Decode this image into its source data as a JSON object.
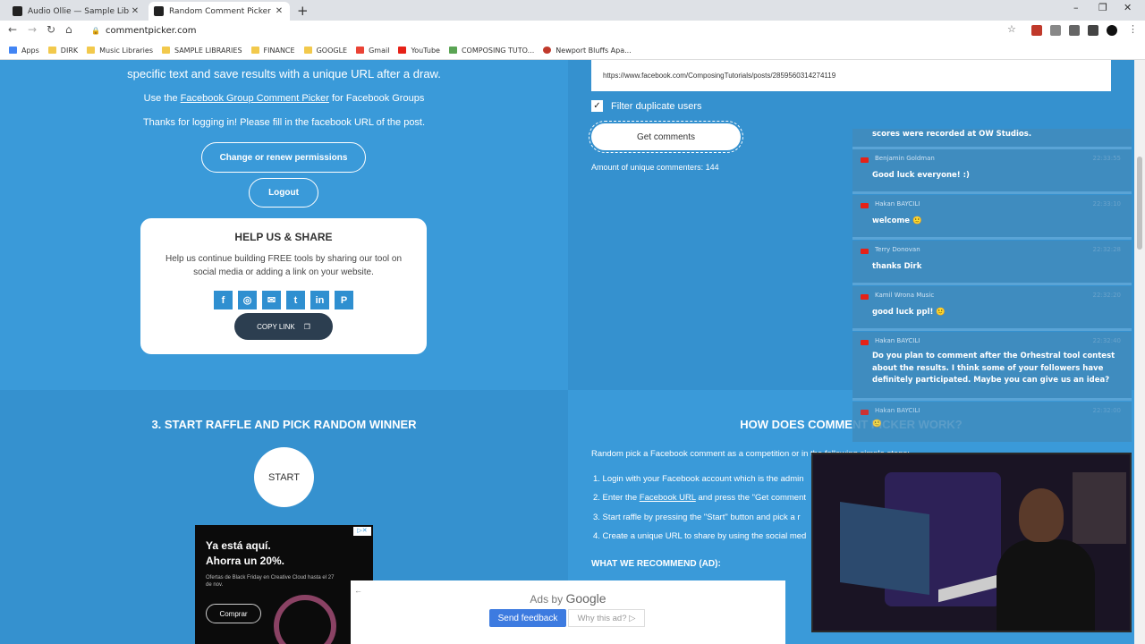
{
  "browser": {
    "tabs": [
      {
        "title": "Audio Ollie — Sample Libraries a"
      },
      {
        "title": "Random Comment Picker for Fac"
      }
    ],
    "url": "commentpicker.com",
    "bookmarks": [
      "Apps",
      "DIRK",
      "Music Libraries",
      "SAMPLE LIBRARIES",
      "FINANCE",
      "GOOGLE",
      "Gmail",
      "YouTube",
      "COMPOSING TUTO...",
      "Newport Bluffs Apa..."
    ]
  },
  "left": {
    "intro": "specific text and save results with a unique URL after a draw.",
    "group_prefix": "Use the ",
    "group_link": "Facebook Group Comment Picker",
    "group_suffix": " for Facebook Groups",
    "logged_in": "Thanks for logging in! Please fill in the facebook URL of the post.",
    "renew_button": "Change or renew permissions",
    "logout_button": "Logout",
    "share_title": "HELP US & SHARE",
    "share_text": "Help us continue building FREE tools by sharing our tool on social media or adding a link on your website.",
    "copy_link": "COPY LINK",
    "raffle_title": "3. START RAFFLE AND PICK RANDOM WINNER",
    "start_button": "START"
  },
  "right": {
    "post_url": "https://www.facebook.com/ComposingTutorials/posts/2859560314274119",
    "filter_label": "Filter duplicate users",
    "get_comments": "Get comments",
    "amount": "Amount of unique commenters: 144",
    "how_title": "HOW DOES COMMENT PICKER WORK?",
    "how_intro": "Random pick a Facebook comment as a competition or",
    "how_intro_tail": "in the following simple steps:",
    "steps": [
      {
        "prefix": "1. Login with your Facebook account which is the admin",
        "link": "",
        "suffix": ""
      },
      {
        "prefix": "2. Enter the ",
        "link": "Facebook URL",
        "suffix": " and press the \"Get comment"
      },
      {
        "prefix": "3. Start raffle by pressing the \"Start\" button and pick a r",
        "link": "",
        "suffix": ""
      },
      {
        "prefix": "4. Create a unique URL to share by using the social med",
        "link": "",
        "suffix": ""
      }
    ],
    "recommend": "WHAT WE RECOMMEND (AD):"
  },
  "comments": [
    {
      "author": "",
      "time": "",
      "message": "scores were recorded at OW Studios."
    },
    {
      "author": "Benjamin Goldman",
      "time": "22:33:55",
      "message": "Good luck everyone! :)"
    },
    {
      "author": "Hakan BAYCILI",
      "time": "22:33:10",
      "message": "welcome 🙂"
    },
    {
      "author": "Terry Donovan",
      "time": "22:32:28",
      "message": "thanks Dirk"
    },
    {
      "author": "Kamil Wrona Music",
      "time": "22:32:20",
      "message": "good luck ppl! 🙂"
    },
    {
      "author": "Hakan BAYCILI",
      "time": "22:32:40",
      "message": "Do you plan to comment after the Orhestral tool contest about the results. I think some of your followers have definitely participated. Maybe you can give us an idea?"
    },
    {
      "author": "Hakan BAYCILI",
      "time": "22:32:00",
      "message": "🙂"
    }
  ],
  "ad": {
    "headline1": "Ya está aquí.",
    "headline2": "Ahorra un 20%.",
    "subtext": "Ofertas de Black Friday en Creative Cloud hasta el 27 de nov.",
    "cta": "Comprar"
  },
  "adsby": {
    "label": "Ads by",
    "brand": "Google",
    "feedback": "Send feedback",
    "why": "Why this ad? ▷"
  },
  "colors": {
    "page_blue": "#3a9ad9",
    "dark_panel": "#2c3e50",
    "youtube_red": "#e62117"
  }
}
